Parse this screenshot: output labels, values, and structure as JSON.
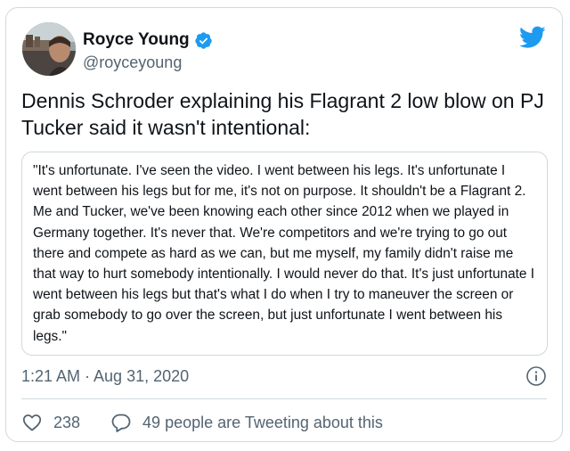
{
  "author": {
    "name": "Royce Young",
    "handle": "@royceyoung",
    "verified": true
  },
  "tweet": {
    "text": "Dennis Schroder explaining his Flagrant 2 low blow on PJ Tucker said it wasn't intentional:",
    "quote": "\"It's unfortunate. I've seen the video. I went between his legs. It's unfortunate I went between his legs but for me, it's not on purpose. It shouldn't be a Flagrant 2. Me and Tucker, we've been knowing each other since 2012 when we played in Germany together. It's never that. We're competitors and we're trying to go out there and compete as hard as we can, but me myself, my family didn't raise me that way to hurt somebody intentionally. I would never do that. It's just unfortunate I went between his legs but that's what I do when I try to maneuver the screen or grab somebody to go over the screen, but just unfortunate I went between his legs.\"",
    "timestamp": "1:21 AM · Aug 31, 2020"
  },
  "actions": {
    "likes": "238",
    "tweeting": "49 people are Tweeting about this"
  },
  "icons": {
    "brand": "twitter-bird-icon",
    "verified": "verified-badge-icon",
    "info": "info-icon",
    "like": "heart-icon",
    "reply": "speech-bubble-icon"
  },
  "colors": {
    "accent": "#1d9bf0",
    "text": "#0f1419",
    "muted": "#536471",
    "border": "#cfd9de"
  }
}
